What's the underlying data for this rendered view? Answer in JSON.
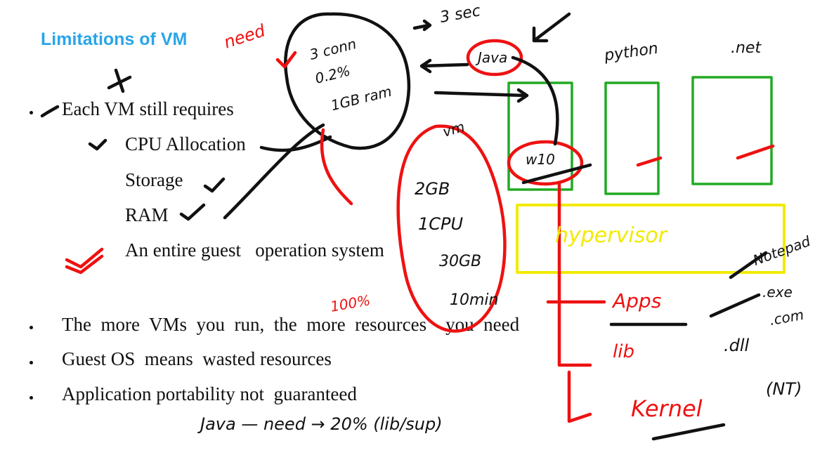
{
  "slide": {
    "title": "Limitations of VM",
    "bullet_intro": "Each  VM still requires",
    "sub_items": [
      "CPU Allocation",
      "Storage",
      "RAM",
      "An entire guest   operation system"
    ],
    "bullets": [
      "The  more  VMs  you  run,  the  more  resources    you  need",
      "Guest OS  means  wasted resources",
      "Application portability not  guaranteed"
    ]
  },
  "annotations": {
    "need": "need",
    "vm_spec_1": [
      "3 conn",
      "0.2%",
      "1GB ram"
    ],
    "sec": "3 sec",
    "java": "Java",
    "python": "python",
    "net": ".net",
    "vm": "vm",
    "w10": "w10",
    "vm_spec_2": [
      "2GB",
      "1CPU",
      "30GB",
      "10min"
    ],
    "hundred_pct": "100%",
    "hypervisor": "hypervisor",
    "apps": "Apps",
    "notepad": "Notepad",
    "exe": ".exe",
    "com": ".com",
    "lib": "lib",
    "dll": ".dll",
    "kernel": "Kernel",
    "nt": "(NT)",
    "java_need": "Java — need → 20% (lib/sup)"
  },
  "colors": {
    "title": "#2aa5e8",
    "ink_red": "#ee1111",
    "ink_black": "#111111",
    "box_green": "#22aa22",
    "box_yellow": "#f2ea00"
  }
}
